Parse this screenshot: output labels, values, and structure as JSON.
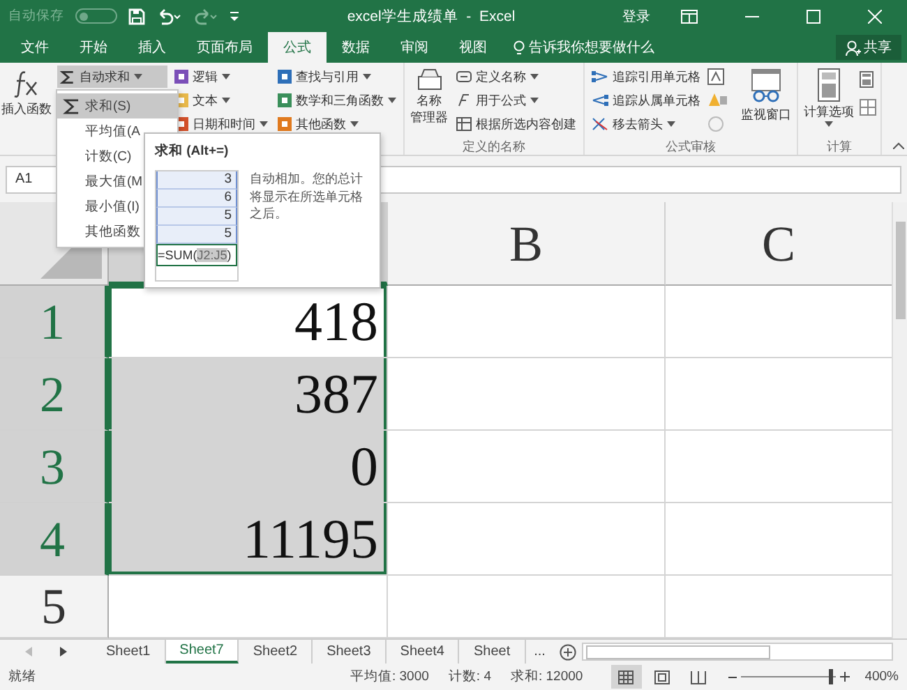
{
  "title_bar": {
    "autosave_label": "自动保存",
    "autosave_on": false,
    "title": "excel学生成绩单  -  Excel",
    "sign_in": "登录"
  },
  "ribbon_tabs": [
    {
      "label": "文件",
      "selected": false
    },
    {
      "label": "开始",
      "selected": false
    },
    {
      "label": "插入",
      "selected": false
    },
    {
      "label": "页面布局",
      "selected": false
    },
    {
      "label": "公式",
      "selected": true
    },
    {
      "label": "数据",
      "selected": false
    },
    {
      "label": "审阅",
      "selected": false
    },
    {
      "label": "视图",
      "selected": false
    }
  ],
  "tell_me": "告诉我你想要做什么",
  "share": "共享",
  "function_library": {
    "insert_function": "插入函数",
    "autosum": "自动求和",
    "functions": [
      {
        "label": "逻辑",
        "color": "#7b4fb8"
      },
      {
        "label": "文本",
        "color": "#e8b84a"
      },
      {
        "label": "日期和时间",
        "color": "#d2502a"
      },
      {
        "label": "查找与引用",
        "color": "#2e6fb8"
      },
      {
        "label": "数学和三角函数",
        "color": "#3a8f5a"
      },
      {
        "label": "其他函数",
        "color": "#e07a1f"
      }
    ]
  },
  "defined_names": {
    "name_manager": [
      "名称",
      "管理器"
    ],
    "items": [
      "定义名称",
      "用于公式",
      "根据所选内容创建"
    ],
    "label": "定义的名称"
  },
  "formula_auditing": {
    "items": [
      "追踪引用单元格",
      "追踪从属单元格",
      "移去箭头"
    ],
    "watch_window": "监视窗口",
    "label": "公式审核"
  },
  "calculation": {
    "options": "计算选项",
    "label": "计算"
  },
  "name_box": "A1",
  "autosum_menu": [
    {
      "label": "求和(S)",
      "selected": true
    },
    {
      "label": "平均值(A",
      "selected": false
    },
    {
      "label": "计数(C)",
      "selected": false
    },
    {
      "label": "最大值(M",
      "selected": false
    },
    {
      "label": "最小值(I)",
      "selected": false
    },
    {
      "label": "其他函数",
      "selected": false
    }
  ],
  "tooltip": {
    "title": "求和 (Alt+=)",
    "description": "自动相加。您的总计将显示在所选单元格之后。",
    "example_values": [
      "3",
      "6",
      "5",
      "5"
    ],
    "formula": "=SUM(",
    "formula_range": "J2:J5",
    "formula_end": ")"
  },
  "columns": [
    {
      "selected": true
    },
    {
      "label": "B",
      "selected": false
    },
    {
      "label": "C",
      "selected": false
    }
  ],
  "rows": [
    {
      "label": "1",
      "selected": true,
      "active": true,
      "value": "418"
    },
    {
      "label": "2",
      "selected": true,
      "active": false,
      "value": "387"
    },
    {
      "label": "3",
      "selected": true,
      "active": false,
      "value": "0"
    },
    {
      "label": "4",
      "selected": true,
      "active": false,
      "value": "11195"
    },
    {
      "label": "5",
      "selected": false,
      "active": false
    }
  ],
  "sheet_tabs": [
    {
      "label": "Sheet1",
      "selected": false
    },
    {
      "label": "Sheet7",
      "selected": true
    },
    {
      "label": "Sheet2",
      "selected": false
    },
    {
      "label": "Sheet3",
      "selected": false
    },
    {
      "label": "Sheet4",
      "selected": false
    },
    {
      "label": "Sheet",
      "selected": false
    }
  ],
  "more_sheets": "...",
  "status_bar": {
    "status": "就绪",
    "average": "平均值: 3000",
    "count": "计数: 4",
    "sum": "求和: 12000",
    "views": [
      {
        "kind": "normal",
        "selected": true
      },
      {
        "kind": "layout",
        "selected": false
      },
      {
        "kind": "break",
        "selected": false
      }
    ],
    "zoom_slider": {
      "level": 0.93
    },
    "zoom": "400%"
  }
}
